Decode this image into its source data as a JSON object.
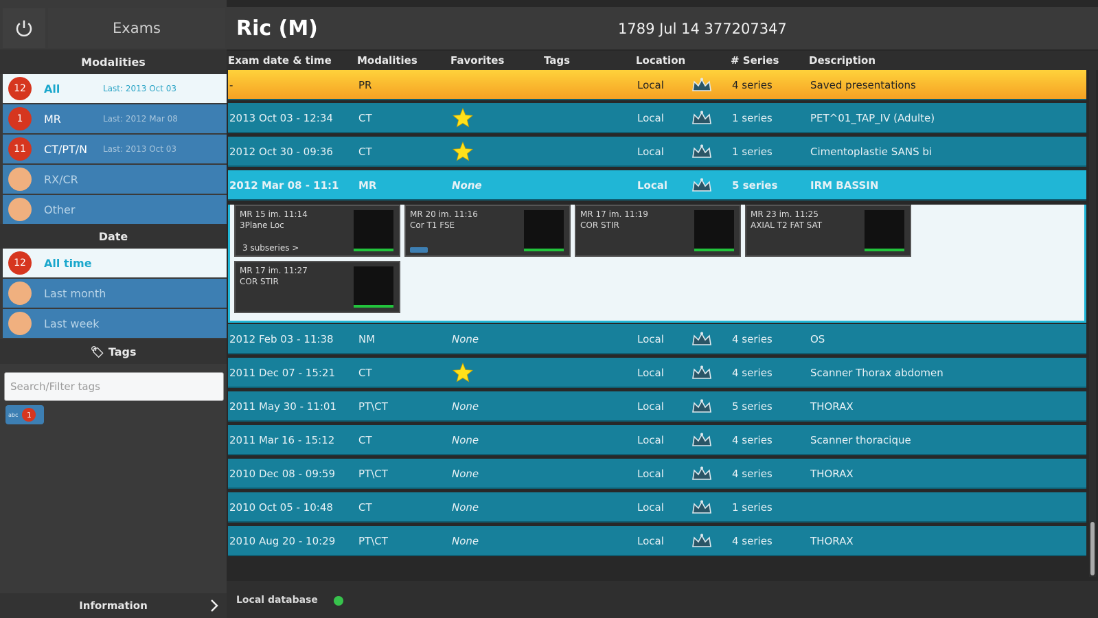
{
  "sidebar": {
    "exams_tab": "Exams",
    "modalities_header": "Modalities",
    "modalities": [
      {
        "count": "12",
        "label": "All",
        "sub": "Last: 2013 Oct 03",
        "selected": true,
        "badge_color": "red"
      },
      {
        "count": "1",
        "label": "MR",
        "sub": "Last: 2012 Mar 08",
        "selected": false,
        "badge_color": "red"
      },
      {
        "count": "11",
        "label": "CT/PT/N",
        "sub": "Last: 2013 Oct 03",
        "selected": false,
        "badge_color": "red"
      },
      {
        "count": "",
        "label": "RX/CR",
        "sub": "",
        "selected": false,
        "badge_color": "peach"
      },
      {
        "count": "",
        "label": "Other",
        "sub": "",
        "selected": false,
        "badge_color": "peach"
      }
    ],
    "date_header": "Date",
    "dates": [
      {
        "count": "12",
        "label": "All time",
        "selected": true,
        "badge_color": "red"
      },
      {
        "count": "",
        "label": "Last month",
        "selected": false,
        "badge_color": "peach"
      },
      {
        "count": "",
        "label": "Last week",
        "selected": false,
        "badge_color": "peach"
      }
    ],
    "tags_header": "Tags",
    "tag_search_placeholder": "Search/Filter tags",
    "tag_chip": {
      "label": "abc",
      "count": "1"
    },
    "information": "Information"
  },
  "patient": {
    "name": "Ric (M)",
    "info": "1789 Jul 14  377207347"
  },
  "columns": [
    "Exam date & time",
    "Modalities",
    "Favorites",
    "Tags",
    "Location",
    "# Series",
    "Description"
  ],
  "exams": [
    {
      "date": "-",
      "modality": "PR",
      "favorite": "",
      "location": "Local",
      "series": "4 series",
      "description": "Saved presentations",
      "kind": "pr"
    },
    {
      "date": "2013 Oct 03 - 12:34",
      "modality": "CT",
      "favorite": "star",
      "location": "Local",
      "series": "1 series",
      "description": "PET^01_TAP_IV (Adulte)",
      "kind": "normal"
    },
    {
      "date": "2012 Oct 30 - 09:36",
      "modality": "CT",
      "favorite": "star",
      "location": "Local",
      "series": "1 series",
      "description": "Cimentoplastie SANS bi",
      "kind": "normal"
    },
    {
      "date": "2012 Mar 08 - 11:1",
      "modality": "MR",
      "favorite": "None",
      "location": "Local",
      "series": "5 series",
      "description": "IRM BASSIN",
      "kind": "selected"
    },
    {
      "date": "2012 Feb 03 - 11:38",
      "modality": "NM",
      "favorite": "None",
      "location": "Local",
      "series": "4 series",
      "description": "OS",
      "kind": "normal"
    },
    {
      "date": "2011 Dec 07 - 15:21",
      "modality": "CT",
      "favorite": "star",
      "location": "Local",
      "series": "4 series",
      "description": "Scanner Thorax abdomen",
      "kind": "normal"
    },
    {
      "date": "2011 May 30 - 11:01",
      "modality": "PT\\CT",
      "favorite": "None",
      "location": "Local",
      "series": "5 series",
      "description": "THORAX",
      "kind": "normal"
    },
    {
      "date": "2011 Mar 16 - 15:12",
      "modality": "CT",
      "favorite": "None",
      "location": "Local",
      "series": "4 series",
      "description": "Scanner thoracique",
      "kind": "normal"
    },
    {
      "date": "2010 Dec 08 - 09:59",
      "modality": "PT\\CT",
      "favorite": "None",
      "location": "Local",
      "series": "4 series",
      "description": "THORAX",
      "kind": "normal"
    },
    {
      "date": "2010 Oct 05 - 10:48",
      "modality": "CT",
      "favorite": "None",
      "location": "Local",
      "series": "1 series",
      "description": "",
      "kind": "normal"
    },
    {
      "date": "2010 Aug 20 - 10:29",
      "modality": "PT\\CT",
      "favorite": "None",
      "location": "Local",
      "series": "4 series",
      "description": "THORAX",
      "kind": "normal"
    }
  ],
  "series_thumbs": [
    {
      "line1": "MR 15 im. 11:14",
      "line2": "3Plane Loc",
      "sub": "3 subseries >"
    },
    {
      "line1": "MR 20 im. 11:16",
      "line2": "Cor T1 FSE",
      "sub": ""
    },
    {
      "line1": "MR 17 im. 11:19",
      "line2": "COR STIR",
      "sub": ""
    },
    {
      "line1": "MR 23 im. 11:25",
      "line2": "AXIAL T2 FAT SAT",
      "sub": ""
    },
    {
      "line1": "MR 17 im. 11:27",
      "line2": "COR STIR",
      "sub": ""
    }
  ],
  "status": {
    "db_label": "Local database",
    "db_status_color": "#37c24c"
  },
  "colors": {
    "accent": "#20b6d6",
    "row": "#17809b",
    "sidebar_item": "#3d7fb3",
    "badge": "#d6361f",
    "favorite": "#ffe11a"
  }
}
